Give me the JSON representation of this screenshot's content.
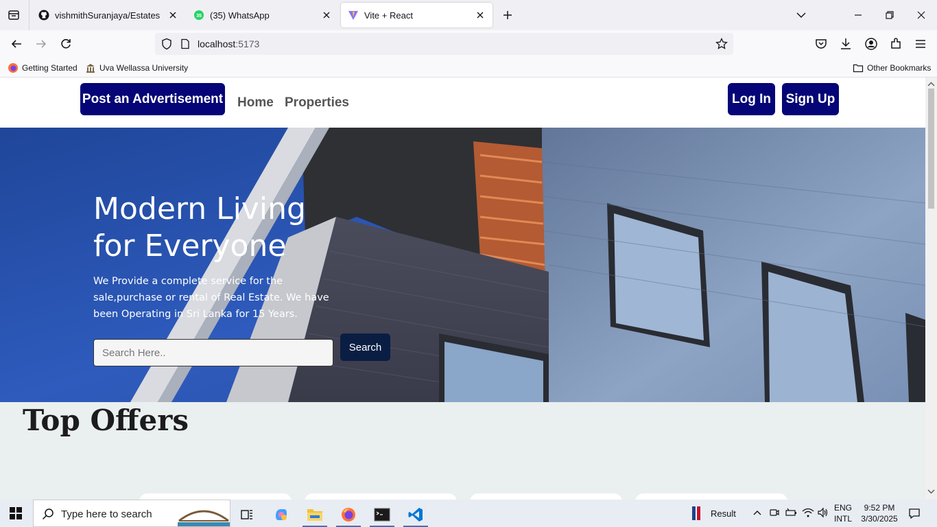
{
  "browser": {
    "tabs": [
      {
        "title": "vishmithSuranjaya/Estates",
        "icon": "github-icon"
      },
      {
        "title": "(35) WhatsApp",
        "icon": "whatsapp-icon",
        "badge": "35"
      },
      {
        "title": "Vite + React",
        "icon": "vite-icon",
        "active": true
      }
    ],
    "url_host": "localhost",
    "url_port": ":5173",
    "bookmarks": [
      {
        "label": "Getting Started",
        "icon": "firefox-icon"
      },
      {
        "label": "Uva Wellassa University",
        "icon": "bookmark-icon"
      }
    ],
    "other_bookmarks": "Other Bookmarks"
  },
  "header": {
    "post_ad": "Post an Advertisement",
    "nav": [
      "Home",
      "Properties"
    ],
    "login": "Log In",
    "signup": "Sign Up"
  },
  "hero": {
    "title_line1": "Modern Living",
    "title_line2": "for Everyone",
    "description": "We Provide a complete service for the sale,purchase or rental of Real Estate. We have been Operating in Sri Lanka for 15 Years.",
    "search_placeholder": "Search Here..",
    "search_button": "Search"
  },
  "sections": {
    "top_offers": "Top Offers"
  },
  "taskbar": {
    "search_placeholder": "Type here to search",
    "result_label": "Result",
    "lang_line1": "ENG",
    "lang_line2": "INTL",
    "time": "9:52 PM",
    "date": "3/30/2025"
  },
  "colors": {
    "navy_button": "#050577",
    "search_button": "#0a1e44",
    "hero_blue": "#2a59b8",
    "page_bg": "#eaefef"
  }
}
